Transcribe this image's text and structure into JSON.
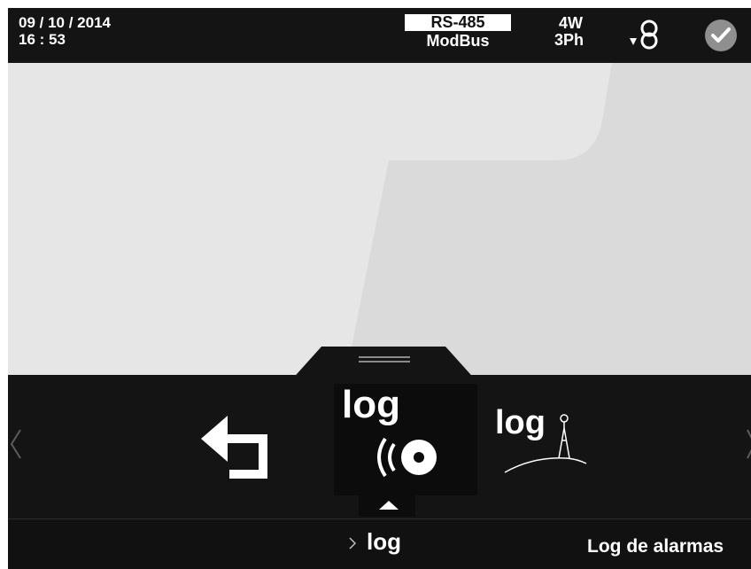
{
  "status_bar": {
    "date": "09 / 10 / 2014",
    "time": "16 : 53",
    "comm_interface": "RS-485",
    "comm_protocol": "ModBus",
    "wiring": "4W",
    "phases": "3Ph",
    "ct_icon": "current-transformer-icon",
    "status_icon": "check-circle-icon",
    "status_color": "#8f8f8f"
  },
  "menu": {
    "items": [
      {
        "id": "back",
        "icon": "back-arrow-icon"
      },
      {
        "id": "log",
        "label": "log",
        "icon": "media-disc-icon",
        "selected": true
      },
      {
        "id": "log-alarms",
        "label": "log",
        "icon": "antenna-icon"
      }
    ]
  },
  "breadcrumb": {
    "path_label": "log",
    "selected_title": "Log de alarmas"
  },
  "colors": {
    "bar_background": "#141414",
    "panel_background": "#e6e6e6",
    "text": "#ffffff"
  }
}
